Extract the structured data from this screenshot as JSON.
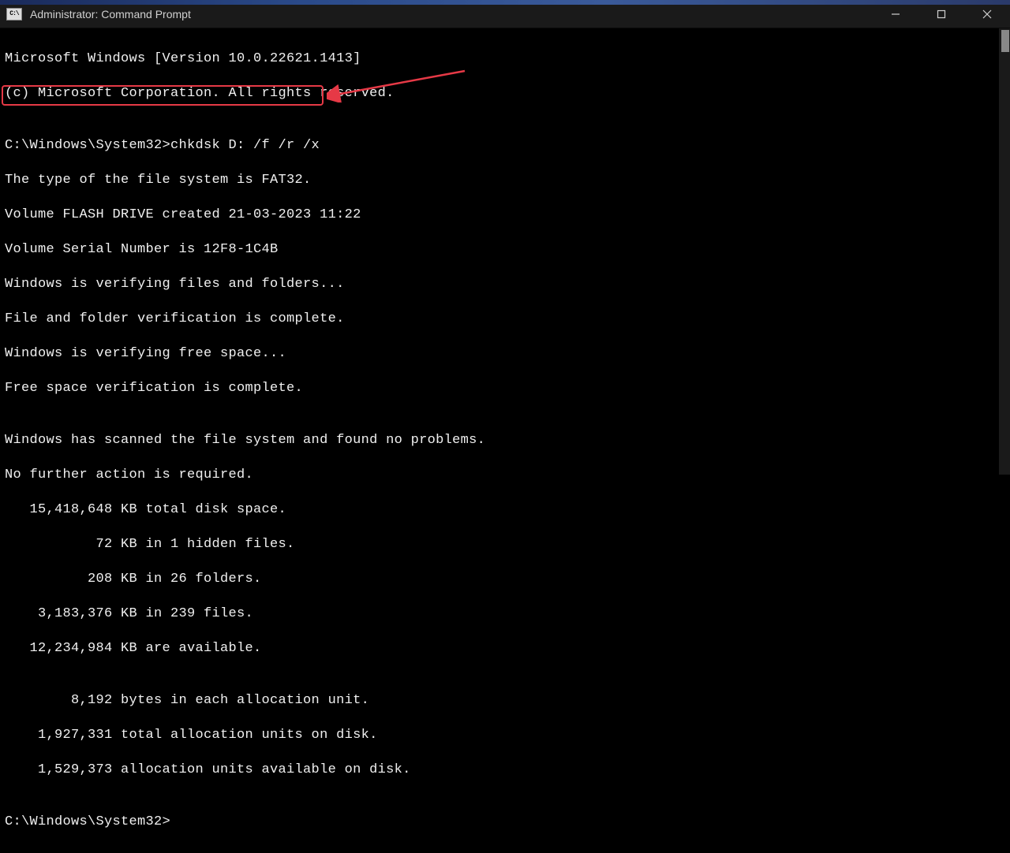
{
  "titlebar": {
    "icon_label": "C:\\",
    "title": "Administrator: Command Prompt"
  },
  "terminal": {
    "lines": [
      "Microsoft Windows [Version 10.0.22621.1413]",
      "(c) Microsoft Corporation. All rights reserved.",
      "",
      "C:\\Windows\\System32>chkdsk D: /f /r /x",
      "The type of the file system is FAT32.",
      "Volume FLASH DRIVE created 21-03-2023 11:22",
      "Volume Serial Number is 12F8-1C4B",
      "Windows is verifying files and folders...",
      "File and folder verification is complete.",
      "Windows is verifying free space...",
      "Free space verification is complete.",
      "",
      "Windows has scanned the file system and found no problems.",
      "No further action is required.",
      "   15,418,648 KB total disk space.",
      "           72 KB in 1 hidden files.",
      "          208 KB in 26 folders.",
      "    3,183,376 KB in 239 files.",
      "   12,234,984 KB are available.",
      "",
      "        8,192 bytes in each allocation unit.",
      "    1,927,331 total allocation units on disk.",
      "    1,529,373 allocation units available on disk.",
      "",
      "C:\\Windows\\System32>"
    ]
  },
  "annotations": {
    "highlight_color": "#e63946"
  }
}
